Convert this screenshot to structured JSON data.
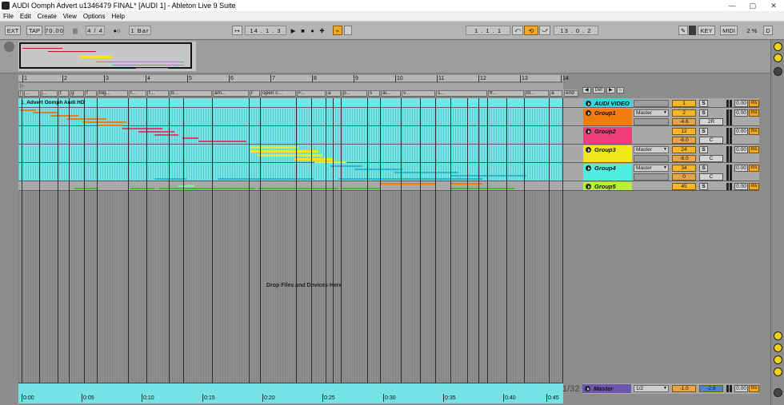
{
  "window": {
    "title": "AUDI Oomph Advert u1346479 FINAL*  [AUDI 1] - Ableton Live 9 Suite",
    "controls": [
      "—",
      "▢",
      "✕"
    ]
  },
  "menu": [
    "File",
    "Edit",
    "Create",
    "View",
    "Options",
    "Help"
  ],
  "control_bar": {
    "ext": "EXT",
    "tap": "TAP",
    "tempo": "70.00",
    "nudge": "|||",
    "signature": "4 / 4",
    "metro": "●○",
    "quantize": "1 Bar",
    "follow": "↦",
    "position": "14 .  1 .  3",
    "play": "▶",
    "stop": "■",
    "record": "●",
    "overdub": "✚",
    "automation": "⌁",
    "loop_start": "1 .  1 .  1",
    "punch_in": "⤺",
    "loop": "⟲",
    "punch_out": "⤻",
    "loop_length": "13 .  0 .  2",
    "draw": "✎",
    "key": "KEY",
    "midi": "MIDI",
    "cpu": "2 %",
    "disk": "D"
  },
  "beat_ruler": [
    "1",
    "2",
    "3",
    "4",
    "5",
    "6",
    "7",
    "8",
    "9",
    "10",
    "11",
    "12",
    "13",
    "14"
  ],
  "loc_row": "▷",
  "markers": [
    "|",
    "...",
    "j...",
    "t",
    "g",
    "f",
    "big...",
    "f...",
    "f...",
    "b...",
    "am...",
    "r",
    "open c...",
    "F...",
    "a",
    "p...",
    "s",
    "ai...",
    "v...",
    "s...",
    "fr...",
    "bl...",
    "a",
    "end"
  ],
  "tracks": [
    {
      "name": "AUDI VIDEO",
      "color": "#35d7df",
      "num": "1",
      "solo": "S",
      "delay": "0.00",
      "ms": "ms"
    },
    {
      "name": "Group1",
      "color": "#f07b0e",
      "route": "Master",
      "num": "2",
      "vol": "-4.6",
      "pan": "2R",
      "solo": "S",
      "delay": "0.00",
      "ms": "ms"
    },
    {
      "name": "Group2",
      "color": "#ef3f79",
      "route": "",
      "num": "12",
      "vol": "-6.0",
      "pan": "C",
      "solo": "S",
      "delay": "0.00",
      "ms": "ms"
    },
    {
      "name": "Group3",
      "color": "#f1e71f",
      "route": "Master",
      "num": "24",
      "vol": "-6.0",
      "pan": "C",
      "solo": "S",
      "delay": "0.00",
      "ms": "ms"
    },
    {
      "name": "Group4",
      "color": "#4eefe0",
      "route": "Master",
      "num": "34",
      "vol": "0",
      "pan": "C",
      "solo": "S",
      "delay": "0.00",
      "ms": "ms"
    },
    {
      "name": "Group5",
      "color": "#b8ef3c",
      "route": "",
      "num": "45",
      "solo": "S",
      "delay": "0.00",
      "ms": "ms"
    }
  ],
  "clip_name": "1_Advert Oomph Audi HD",
  "drop_text": "Drop Files and Devices Here",
  "head_top": {
    "back": "◀",
    "def": "Def",
    "ret": "▶",
    "lock": "⌂"
  },
  "master": {
    "name": "Master",
    "route": "1/2",
    "vol": "-1.0",
    "pan": "-2.6",
    "delay": "0.00",
    "ms": "ms"
  },
  "zoom_label": "1/32",
  "time_ruler": [
    "0:00",
    "0:05",
    "0:10",
    "0:15",
    "0:20",
    "0:25",
    "0:30",
    "0:35",
    "0:40",
    "0:45"
  ],
  "colors": {
    "clip_cyan": "#73e6e8",
    "orange": "#f07b0e",
    "pink": "#e23b7c",
    "yellow": "#f1e71f",
    "green": "#3fbf2e",
    "accent": "#f5a623"
  }
}
